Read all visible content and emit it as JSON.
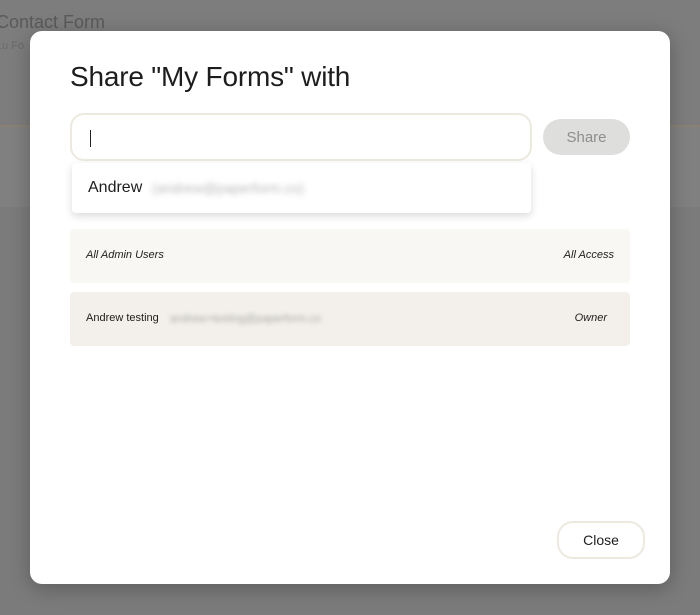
{
  "background": {
    "title": "Contact Form",
    "subtitle": "Lu Fo"
  },
  "modal": {
    "title": "Share \"My Forms\" with",
    "search": {
      "value": "",
      "placeholder": ""
    },
    "share_label": "Share",
    "suggestion": {
      "name": "Andrew",
      "email": "(andrew@paperform.co)"
    },
    "rows": [
      {
        "label": "All Admin Users",
        "email": "",
        "role": "All Access"
      },
      {
        "label": "Andrew testing",
        "email": "andrew+testing@paperform.co",
        "role": "Owner"
      }
    ],
    "close_label": "Close"
  },
  "colors": {
    "overlay": "#7b7b7b",
    "modal_bg": "#ffffff",
    "row_light": "#f9f7f3",
    "row_warm": "#f3f0eb",
    "share_disabled": "#dededc",
    "border": "#ece9df"
  }
}
